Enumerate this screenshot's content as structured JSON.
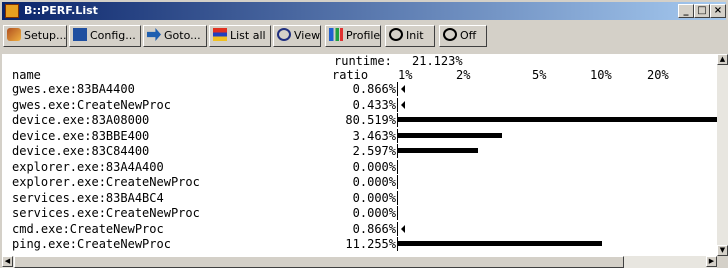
{
  "window": {
    "title": "B::PERF.List",
    "min": "_",
    "max": "□",
    "close": "×"
  },
  "toolbar": [
    {
      "label": "Setup...",
      "icon": "setup-icon"
    },
    {
      "label": "Config...",
      "icon": "config-icon"
    },
    {
      "label": "Goto...",
      "icon": "goto-icon"
    },
    {
      "label": "List all",
      "icon": "list-icon"
    },
    {
      "label": "View",
      "icon": "view-icon"
    },
    {
      "label": "Profile",
      "icon": "profile-icon"
    },
    {
      "label": "Init",
      "icon": "init-icon"
    },
    {
      "label": "Off",
      "icon": "off-icon"
    }
  ],
  "header": {
    "runtime_label": "runtime:",
    "runtime_value": "21.123%",
    "name_col": "name",
    "ratio_col": "ratio",
    "scale_ticks": [
      "1%",
      "2%",
      "5%",
      "10%",
      "20%"
    ]
  },
  "rows": [
    {
      "name": "gwes.exe:83BA4400",
      "ratio": "0.866%",
      "value": 0.866
    },
    {
      "name": "gwes.exe:CreateNewProc",
      "ratio": "0.433%",
      "value": 0.433
    },
    {
      "name": "device.exe:83A08000",
      "ratio": "80.519%",
      "value": 80.519
    },
    {
      "name": "device.exe:83BBE400",
      "ratio": "3.463%",
      "value": 3.463
    },
    {
      "name": "device.exe:83C84400",
      "ratio": "2.597%",
      "value": 2.597
    },
    {
      "name": "explorer.exe:83A4A400",
      "ratio": "0.000%",
      "value": 0.0
    },
    {
      "name": "explorer.exe:CreateNewProc",
      "ratio": "0.000%",
      "value": 0.0
    },
    {
      "name": "services.exe:83BA4BC4",
      "ratio": "0.000%",
      "value": 0.0
    },
    {
      "name": "services.exe:CreateNewProc",
      "ratio": "0.000%",
      "value": 0.0
    },
    {
      "name": "cmd.exe:CreateNewProc",
      "ratio": "0.866%",
      "value": 0.866
    },
    {
      "name": "ping.exe:CreateNewProc",
      "ratio": "11.255%",
      "value": 11.255
    }
  ]
}
